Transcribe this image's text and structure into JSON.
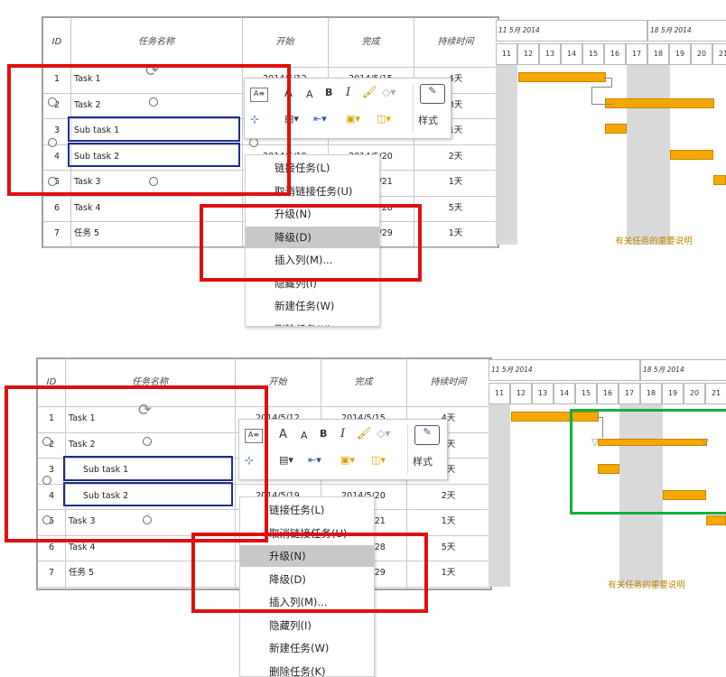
{
  "columns": {
    "id": "ID",
    "name": "任务名称",
    "start": "开始",
    "finish": "完成",
    "duration": "持续时间"
  },
  "timeline": {
    "week1": "11 5月 2014",
    "week2": "18 5月 2014",
    "days": [
      "11",
      "12",
      "13",
      "14",
      "15",
      "16",
      "17",
      "18",
      "19",
      "20",
      "21"
    ]
  },
  "top": {
    "rows": [
      {
        "id": "1",
        "name": "Task 1",
        "start": "2014/5/12",
        "finish": "2014/5/15",
        "duration": "4天"
      },
      {
        "id": "2",
        "name": "Task 2",
        "start": "",
        "finish": "",
        "duration": "3天"
      },
      {
        "id": "3",
        "name": "Sub task 1",
        "start": "",
        "finish": "",
        "duration": "1天"
      },
      {
        "id": "4",
        "name": "Sub task 2",
        "start": "2014/5/19",
        "finish": "2014/5/20",
        "duration": "2天"
      },
      {
        "id": "5",
        "name": "Task 3",
        "start": "",
        "finish": "2014/5/21",
        "duration": "1天"
      },
      {
        "id": "6",
        "name": "Task 4",
        "start": "",
        "finish": "2014/5/28",
        "duration": "5天"
      },
      {
        "id": "7",
        "name": "任务 5",
        "start": "",
        "finish": "2014/5/29",
        "duration": "1天"
      }
    ],
    "menu": [
      "链接任务(L)",
      "取消链接任务(U)",
      "升级(N)",
      "降级(D)",
      "插入列(M)...",
      "隐藏列(I)",
      "新建任务(W)",
      "删除任务(K)"
    ],
    "highlighted": "降级(D)",
    "note": "有关任务的重要说明"
  },
  "bottom": {
    "rows": [
      {
        "id": "1",
        "name": "Task 1",
        "start": "2014/5/12",
        "finish": "2014/5/15",
        "duration": "4天"
      },
      {
        "id": "2",
        "name": "Task 2",
        "start": "",
        "finish": "",
        "duration": "5天"
      },
      {
        "id": "3",
        "name": "Sub task 1",
        "start": "",
        "finish": "",
        "duration": "1天"
      },
      {
        "id": "4",
        "name": "Sub task 2",
        "start": "2014/5/19",
        "finish": "2014/5/20",
        "duration": "2天"
      },
      {
        "id": "5",
        "name": "Task 3",
        "start": "",
        "finish": "2014/5/21",
        "duration": "1天"
      },
      {
        "id": "6",
        "name": "Task 4",
        "start": "",
        "finish": "2014/5/28",
        "duration": "5天"
      },
      {
        "id": "7",
        "name": "任务 5",
        "start": "",
        "finish": "2014/5/29",
        "duration": "1天"
      }
    ],
    "menu": [
      "链接任务(L)",
      "取消链接任务(U)",
      "升级(N)",
      "降级(D)",
      "插入列(M)...",
      "隐藏列(I)",
      "新建任务(W)",
      "删除任务(K)"
    ],
    "highlighted": "升级(N)",
    "note": "有关任务的重要说明"
  },
  "toolbar": {
    "style_label": "样式",
    "bold": "B",
    "italic": "I",
    "font_grow": "A",
    "font_shrink": "A"
  },
  "colors": {
    "bar": "#f5a800",
    "red_box": "#e01010",
    "green_box": "#10b040",
    "selection": "#1f2f8a"
  }
}
